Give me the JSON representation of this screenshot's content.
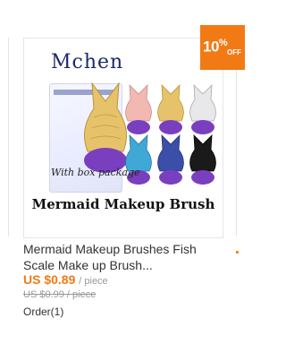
{
  "discount": {
    "value": "10",
    "percent": "%",
    "off": "OFF"
  },
  "image": {
    "brand": "Mchen",
    "package_caption": "With box package",
    "title": "Mermaid Makeup Brush"
  },
  "product": {
    "title": "Mermaid Makeup Brushes Fish Scale Make up Brush...",
    "price": "US $0.89",
    "price_unit": "/ piece",
    "original_price": "US $0.99 / piece",
    "orders": "Order(1)"
  },
  "colors": {
    "accent": "#f27a15",
    "brush_colors": [
      "#f2b9b3",
      "#e6c36a",
      "#e8e8ea",
      "#3fa8d6",
      "#3b4ea8",
      "#1a1a1a"
    ],
    "bristle": "#7a3fbf"
  }
}
